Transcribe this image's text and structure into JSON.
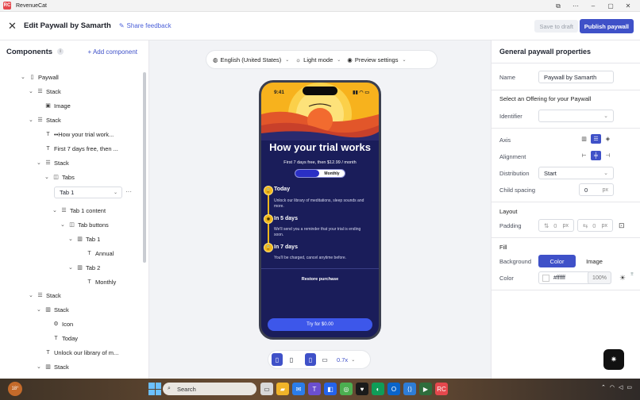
{
  "window": {
    "app_name": "RevenueCat",
    "app_logo": "RC"
  },
  "header": {
    "title": "Edit Paywall by Samarth",
    "share_feedback": "Share feedback",
    "save_draft": "Save to draft",
    "publish": "Publish paywall"
  },
  "left": {
    "title": "Components",
    "info": "i",
    "add_component": "+ Add component",
    "tree": [
      {
        "label": "Paywall",
        "icon": "phone-icon"
      },
      {
        "label": "Stack",
        "icon": "stack-icon"
      },
      {
        "label": "Image",
        "icon": "image-icon"
      },
      {
        "label": "Stack",
        "icon": "stack-icon"
      },
      {
        "label": "••How your trial work...",
        "icon": "text-icon"
      },
      {
        "label": "First 7 days free, then ...",
        "icon": "text-icon"
      },
      {
        "label": "Stack",
        "icon": "stack-icon"
      },
      {
        "label": "Tabs",
        "icon": "tabs-icon"
      },
      {
        "label": "Tab 1 content",
        "icon": "stack-icon"
      },
      {
        "label": "Tab buttons",
        "icon": "tabs-icon"
      },
      {
        "label": "Tab 1",
        "icon": "columns-icon"
      },
      {
        "label": "Annual",
        "icon": "text-icon"
      },
      {
        "label": "Tab 2",
        "icon": "columns-icon"
      },
      {
        "label": "Monthly",
        "icon": "text-icon"
      },
      {
        "label": "Stack",
        "icon": "stack-icon"
      },
      {
        "label": "Stack",
        "icon": "columns-icon"
      },
      {
        "label": "Icon",
        "icon": "gear-icon"
      },
      {
        "label": "Today",
        "icon": "text-icon"
      },
      {
        "label": "Unlock our library of m...",
        "icon": "text-icon"
      },
      {
        "label": "Stack",
        "icon": "columns-icon"
      }
    ],
    "tab_select": "Tab 1",
    "tab_more": "···"
  },
  "canvas": {
    "locale": "English (United States)",
    "mode": "Light mode",
    "preview": "Preview settings",
    "zoom": "0.7x"
  },
  "phone": {
    "time": "9:41",
    "hero": "How your trial works",
    "sub": "First 7 days free, then $12.99 / month",
    "toggle_right": "Monthly",
    "timeline": [
      {
        "title": "Today",
        "desc": "Unlock our library of meditations, sleep sounds and more."
      },
      {
        "title": "In 5 days",
        "desc": "We'll send you a reminder that your trial is ending soon."
      },
      {
        "title": "In 7 days",
        "desc": "You'll be charged, cancel anytime before."
      }
    ],
    "restore": "Restore purchase",
    "cta": "Try for $0.00"
  },
  "right": {
    "title": "General paywall properties",
    "name_label": "Name",
    "name_value": "Paywall by Samarth",
    "offering_label": "Select an Offering for your Paywall",
    "identifier_label": "Identifier",
    "axis_label": "Axis",
    "alignment_label": "Alignment",
    "distribution_label": "Distribution",
    "distribution_value": "Start",
    "spacing_label": "Child spacing",
    "spacing_value": "0",
    "unit": "px",
    "layout_section": "Layout",
    "padding_label": "Padding",
    "padding_v": "0",
    "padding_h": "0",
    "fill_section": "Fill",
    "background_label": "Background",
    "bg_color_tab": "Color",
    "bg_image_tab": "Image",
    "color_label": "Color",
    "color_value": "#ffffff",
    "opacity": "100%"
  },
  "taskbar": {
    "search": "Search",
    "weather": "18°"
  },
  "colors": {
    "accent": "#3f51c8",
    "phone_bg": "#1a1d5a",
    "cta": "#3d57ea",
    "sun": "#f2b81c"
  }
}
